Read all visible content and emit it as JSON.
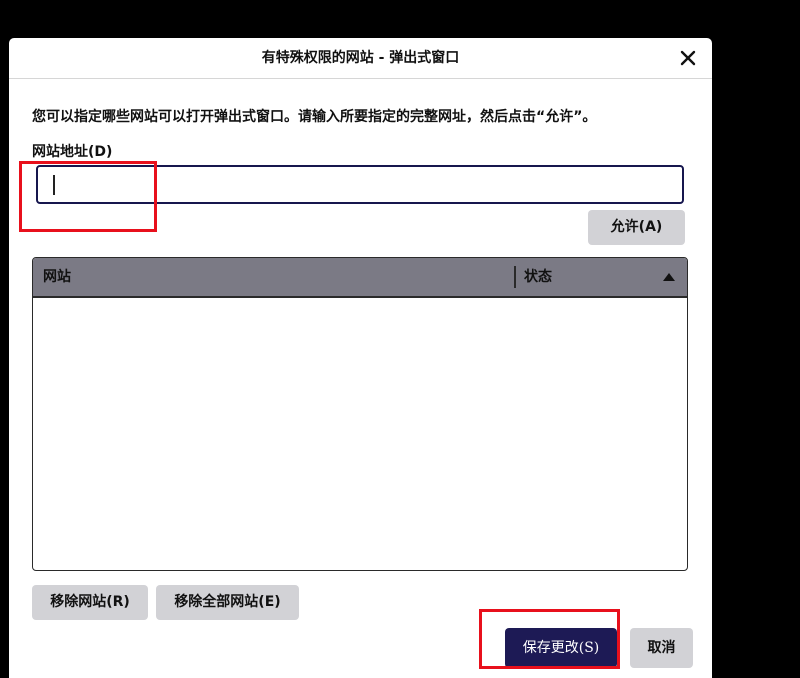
{
  "dialog": {
    "title": "有特殊权限的网站 - 弹出式窗口",
    "close_icon": "close-icon"
  },
  "description": "您可以指定哪些网站可以打开弹出式窗口。请输入所要指定的完整网址，然后点击“允许”。",
  "url_field": {
    "label": "网站地址(D)",
    "value": "",
    "placeholder": ""
  },
  "allow_button": "允许(A)",
  "site_list": {
    "columns": [
      "网站",
      "状态"
    ],
    "rows": [],
    "sort_icon": "sort-ascending-icon"
  },
  "remove_button": "移除网站(R)",
  "remove_all_button": "移除全部网站(E)",
  "save_button": "保存更改(S)",
  "cancel_button": "取消",
  "colors": {
    "primary_button": "#1d1a55",
    "header_bg": "#7b7a85",
    "highlight": "#e8101c"
  }
}
